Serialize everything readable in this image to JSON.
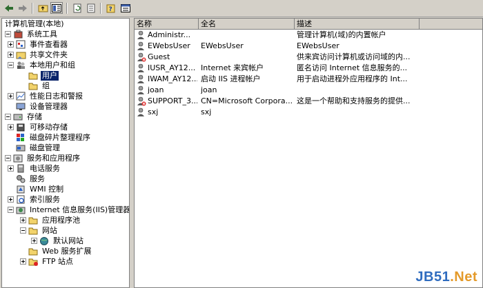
{
  "toolbar": {
    "buttons": [
      "back-icon",
      "forward-icon",
      "up-folder-icon",
      "show-hide-tree-icon",
      "refresh-icon",
      "export-list-icon",
      "help-icon",
      "properties-icon"
    ]
  },
  "tree": {
    "root": "计算机管理(本地)",
    "system_tools": "系统工具",
    "event_viewer": "事件查看器",
    "shared_folders": "共享文件夹",
    "local_users_groups": "本地用户和组",
    "users": "用户",
    "groups": "组",
    "perf_logs": "性能日志和警报",
    "device_manager": "设备管理器",
    "storage": "存储",
    "removable_storage": "可移动存储",
    "disk_defrag": "磁盘碎片整理程序",
    "disk_management": "磁盘管理",
    "services_apps": "服务和应用程序",
    "telephony": "电话服务",
    "services": "服务",
    "wmi": "WMI 控制",
    "indexing": "索引服务",
    "iis": "Internet 信息服务(IIS)管理器",
    "app_pools": "应用程序池",
    "websites": "网站",
    "default_site": "默认网站",
    "web_ext": "Web 服务扩展",
    "ftp_sites": "FTP 站点"
  },
  "list": {
    "columns": [
      "名称",
      "全名",
      "描述"
    ],
    "rows": [
      {
        "name": "Administr...",
        "fullname": "",
        "desc": "管理计算机(域)的内置帐户",
        "disabled": false
      },
      {
        "name": "EWebsUser",
        "fullname": "EWebsUser",
        "desc": "EWebsUser",
        "disabled": false
      },
      {
        "name": "Guest",
        "fullname": "",
        "desc": "供来宾访问计算机或访问域的内...",
        "disabled": true
      },
      {
        "name": "IUSR_AY12...",
        "fullname": "Internet 来宾帐户",
        "desc": "匿名访问 Internet 信息服务的...",
        "disabled": false
      },
      {
        "name": "IWAM_AY12...",
        "fullname": "启动 IIS 进程帐户",
        "desc": "用于启动进程外应用程序的 Int...",
        "disabled": false
      },
      {
        "name": "joan",
        "fullname": "joan",
        "desc": "",
        "disabled": false
      },
      {
        "name": "SUPPORT_3...",
        "fullname": "CN=Microsoft Corpora...",
        "desc": "这是一个帮助和支持服务的提供...",
        "disabled": true
      },
      {
        "name": "sxj",
        "fullname": "sxj",
        "desc": "",
        "disabled": false
      }
    ]
  },
  "watermark": {
    "part1": "JB51",
    "part2": ".Net"
  }
}
